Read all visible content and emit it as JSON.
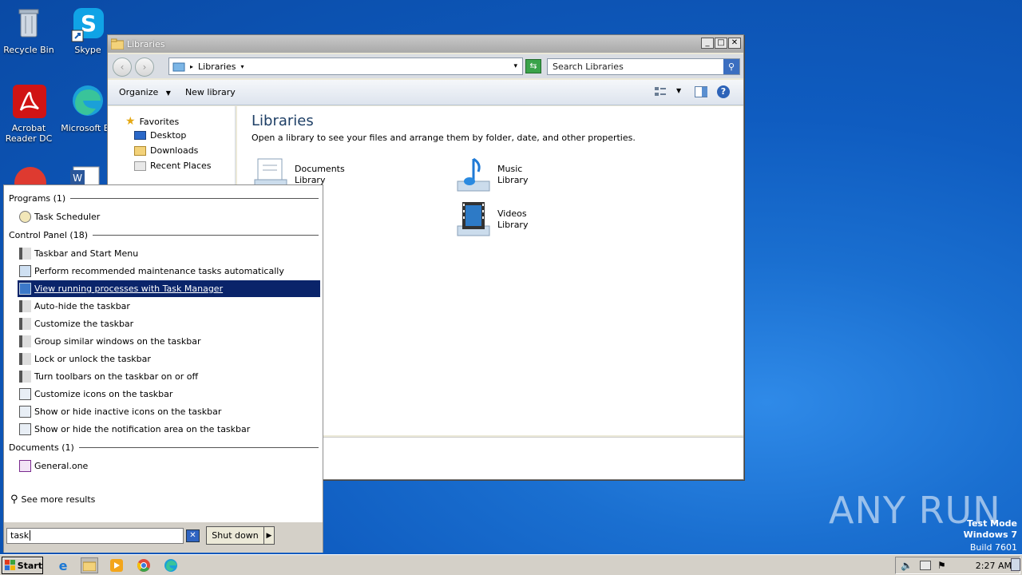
{
  "desktop": {
    "icons": [
      {
        "label": "Recycle Bin"
      },
      {
        "label": "Skype"
      },
      {
        "label": "Acrobat Reader DC"
      },
      {
        "label": "Microsoft Ed"
      }
    ],
    "watermark_line1": "Test Mode",
    "watermark_line2": "Windows 7",
    "watermark_line3": "Build 7601",
    "brand": "ANY RUN"
  },
  "explorer": {
    "title": "Libraries",
    "address": "Libraries",
    "search_placeholder": "Search Libraries",
    "commands": {
      "organize": "Organize",
      "new_library": "New library"
    },
    "nav": {
      "favorites": "Favorites",
      "items": [
        "Desktop",
        "Downloads",
        "Recent Places"
      ]
    },
    "heading": "Libraries",
    "subheading": "Open a library to see your files and arrange them by folder, date, and other properties.",
    "libraries": [
      {
        "name": "Documents",
        "type": "Library"
      },
      {
        "name": "Music",
        "type": "Library"
      },
      {
        "name": "Videos",
        "type": "Library"
      }
    ]
  },
  "start_menu": {
    "groups": {
      "programs": "Programs (1)",
      "control_panel": "Control Panel (18)",
      "documents": "Documents (1)"
    },
    "programs": [
      "Task Scheduler"
    ],
    "control_panel": [
      "Taskbar and Start Menu",
      "Perform recommended maintenance tasks automatically",
      "View running processes with Task Manager",
      "Auto-hide the taskbar",
      "Customize the taskbar",
      "Group similar windows on the taskbar",
      "Lock or unlock the taskbar",
      "Turn toolbars on the taskbar on or off",
      "Customize icons on the taskbar",
      "Show or hide inactive icons on the taskbar",
      "Show or hide the notification area on the taskbar"
    ],
    "selected_index": 2,
    "documents": [
      "General.one"
    ],
    "see_more": "See more results",
    "search_value": "task",
    "shutdown_label": "Shut down"
  },
  "taskbar": {
    "start_label": "Start",
    "clock": "2:27 AM"
  }
}
